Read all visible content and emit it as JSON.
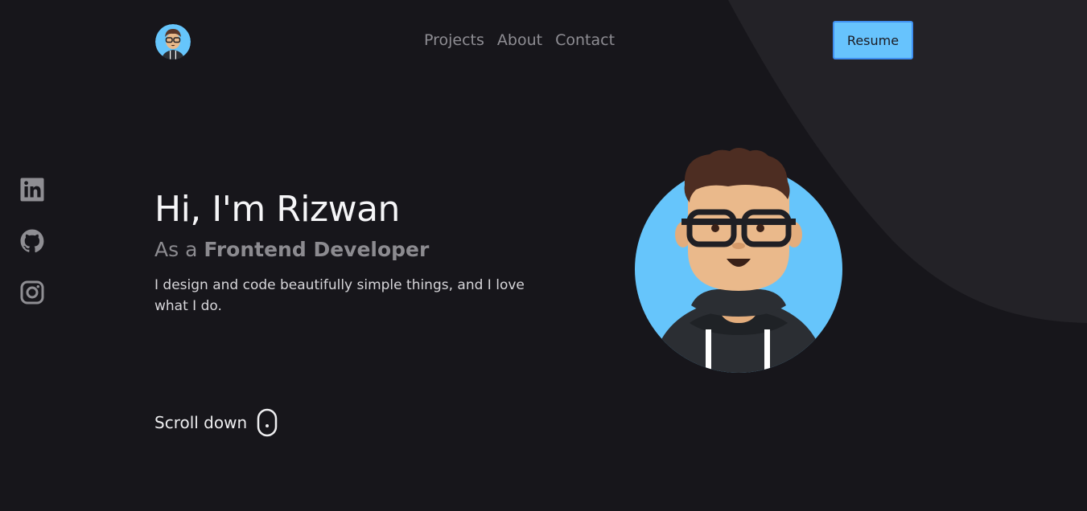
{
  "header": {
    "logo_icon": "avatar-logo",
    "nav": [
      {
        "label": "Projects"
      },
      {
        "label": "About"
      },
      {
        "label": "Contact"
      }
    ],
    "resume_label": "Resume"
  },
  "social": [
    {
      "icon": "linkedin-icon"
    },
    {
      "icon": "github-icon"
    },
    {
      "icon": "instagram-icon"
    }
  ],
  "hero": {
    "greeting": "Hi, I'm Rizwan",
    "role_prefix": "As a",
    "role": "Frontend Developer",
    "description": "I design and code beautifully simple things, and I love what I do."
  },
  "scroll": {
    "label": "Scroll down",
    "icon": "mouse-icon"
  },
  "colors": {
    "background": "#17161b",
    "shape": "#232227",
    "accent": "#67c3fd",
    "accent_border": "#3f8ff0",
    "muted_text": "#8c8b90"
  }
}
